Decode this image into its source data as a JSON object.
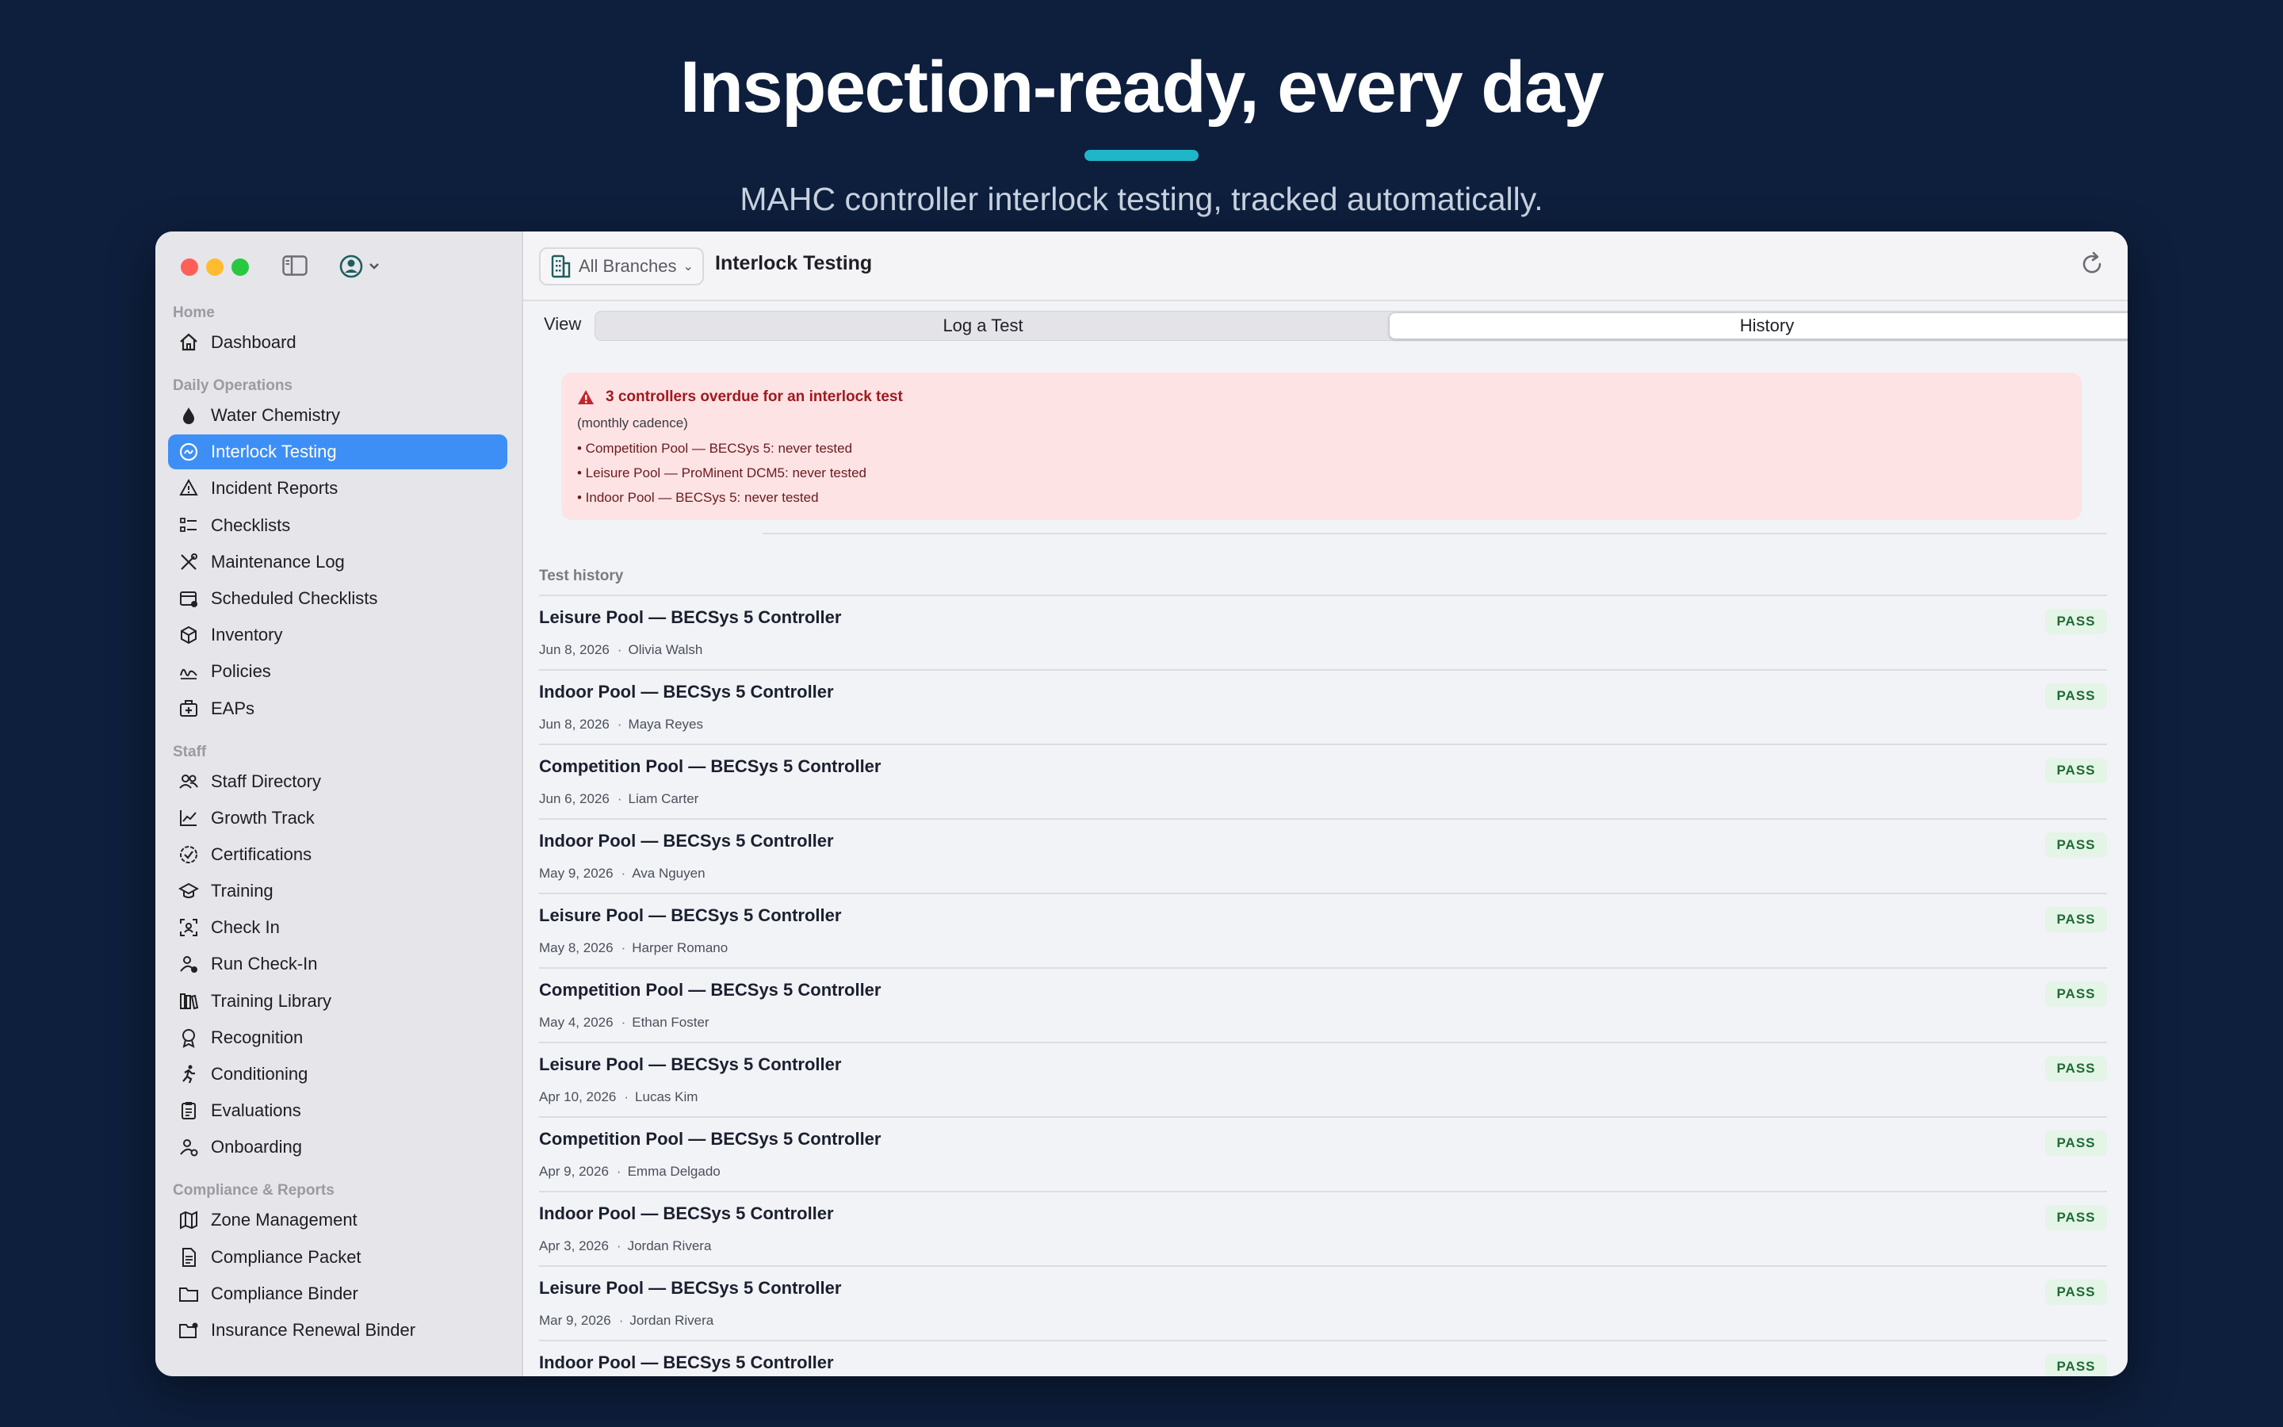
{
  "hero": {
    "title": "Inspection-ready, every day",
    "subtitle": "MAHC controller interlock testing, tracked automatically."
  },
  "sidebar": {
    "sections": [
      {
        "title": "Home",
        "items": [
          {
            "label": "Dashboard",
            "icon": "house-icon"
          }
        ]
      },
      {
        "title": "Daily Operations",
        "items": [
          {
            "label": "Water Chemistry",
            "icon": "drop-icon"
          },
          {
            "label": "Interlock Testing",
            "icon": "gauge-icon",
            "active": true
          },
          {
            "label": "Incident Reports",
            "icon": "warning-triangle-icon"
          },
          {
            "label": "Checklists",
            "icon": "checklist-icon"
          },
          {
            "label": "Maintenance Log",
            "icon": "wrench-screwdriver-icon"
          },
          {
            "label": "Scheduled Checklists",
            "icon": "calendar-badge-icon"
          },
          {
            "label": "Inventory",
            "icon": "box-icon"
          },
          {
            "label": "Policies",
            "icon": "signature-icon"
          },
          {
            "label": "EAPs",
            "icon": "first-aid-kit-icon"
          }
        ]
      },
      {
        "title": "Staff",
        "items": [
          {
            "label": "Staff Directory",
            "icon": "people-icon"
          },
          {
            "label": "Growth Track",
            "icon": "trend-chart-icon"
          },
          {
            "label": "Certifications",
            "icon": "check-seal-icon"
          },
          {
            "label": "Training",
            "icon": "graduation-cap-icon"
          },
          {
            "label": "Check In",
            "icon": "person-viewfinder-icon"
          },
          {
            "label": "Run Check-In",
            "icon": "person-badge-icon"
          },
          {
            "label": "Training Library",
            "icon": "books-icon"
          },
          {
            "label": "Recognition",
            "icon": "award-icon"
          },
          {
            "label": "Conditioning",
            "icon": "figure-run-icon"
          },
          {
            "label": "Evaluations",
            "icon": "clipboard-icon"
          },
          {
            "label": "Onboarding",
            "icon": "person-gear-icon"
          }
        ]
      },
      {
        "title": "Compliance & Reports",
        "items": [
          {
            "label": "Zone Management",
            "icon": "map-icon"
          },
          {
            "label": "Compliance Packet",
            "icon": "document-icon"
          },
          {
            "label": "Compliance Binder",
            "icon": "folder-icon"
          },
          {
            "label": "Insurance Renewal Binder",
            "icon": "folder-badge-icon"
          }
        ]
      }
    ]
  },
  "toolbar": {
    "branch_label": "All Branches",
    "title": "Interlock Testing"
  },
  "view": {
    "label": "View",
    "options": [
      "Log a Test",
      "History"
    ],
    "selected": "History"
  },
  "alert": {
    "title": "3 controllers overdue for an interlock test",
    "subtitle": "(monthly cadence)",
    "lines": [
      "• Competition Pool — BECSys 5: never tested",
      "• Leisure Pool — ProMinent DCM5: never tested",
      "• Indoor Pool — BECSys 5: never tested"
    ]
  },
  "history": {
    "header": "Test history",
    "rows": [
      {
        "title": "Leisure Pool — BECSys 5 Controller",
        "date": "Jun 8, 2026",
        "person": "Olivia Walsh",
        "status": "PASS"
      },
      {
        "title": "Indoor Pool — BECSys 5 Controller",
        "date": "Jun 8, 2026",
        "person": "Maya Reyes",
        "status": "PASS"
      },
      {
        "title": "Competition Pool — BECSys 5 Controller",
        "date": "Jun 6, 2026",
        "person": "Liam Carter",
        "status": "PASS"
      },
      {
        "title": "Indoor Pool — BECSys 5 Controller",
        "date": "May 9, 2026",
        "person": "Ava Nguyen",
        "status": "PASS"
      },
      {
        "title": "Leisure Pool — BECSys 5 Controller",
        "date": "May 8, 2026",
        "person": "Harper Romano",
        "status": "PASS"
      },
      {
        "title": "Competition Pool — BECSys 5 Controller",
        "date": "May 4, 2026",
        "person": "Ethan Foster",
        "status": "PASS"
      },
      {
        "title": "Leisure Pool — BECSys 5 Controller",
        "date": "Apr 10, 2026",
        "person": "Lucas Kim",
        "status": "PASS"
      },
      {
        "title": "Competition Pool — BECSys 5 Controller",
        "date": "Apr 9, 2026",
        "person": "Emma Delgado",
        "status": "PASS"
      },
      {
        "title": "Indoor Pool — BECSys 5 Controller",
        "date": "Apr 3, 2026",
        "person": "Jordan Rivera",
        "status": "PASS"
      },
      {
        "title": "Leisure Pool — BECSys 5 Controller",
        "date": "Mar 9, 2026",
        "person": "Jordan Rivera",
        "status": "PASS"
      },
      {
        "title": "Indoor Pool — BECSys 5 Controller",
        "date": "",
        "person": "",
        "status": "PASS"
      }
    ]
  },
  "colors": {
    "background": "#0e1f3d",
    "accent": "#1fb6c9",
    "selection": "#3d8ff6",
    "alert_bg": "#fde3e4",
    "alert_text": "#a0191f",
    "pass_bg": "#e4f4e7",
    "pass_text": "#1e6b33"
  }
}
